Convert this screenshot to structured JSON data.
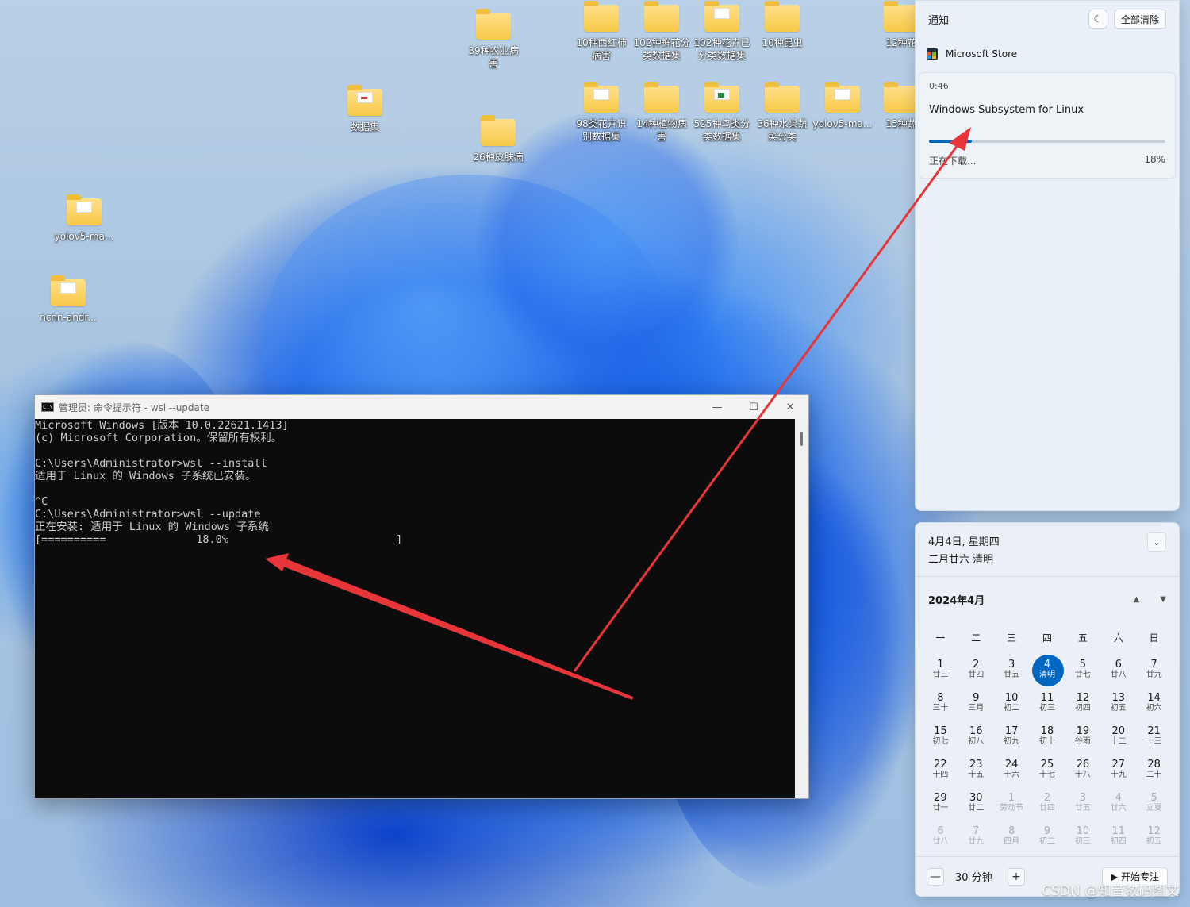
{
  "desktop": {
    "icons": [
      {
        "label": "39种农业病\n害",
        "paper": ""
      },
      {
        "label": "数据集",
        "paper": "red"
      },
      {
        "label": "26种皮肤病",
        "paper": ""
      },
      {
        "label": "yolov5-ma...",
        "paper": "plain"
      },
      {
        "label": "ncnn-andr...",
        "paper": "plain"
      },
      {
        "label": "10种西红柿\n病害",
        "paper": ""
      },
      {
        "label": "102种鲜花分\n类数据集",
        "paper": ""
      },
      {
        "label": "102种花卉已\n分类数据集",
        "paper": "plain"
      },
      {
        "label": "10种昆虫",
        "paper": ""
      },
      {
        "label": "12种花",
        "paper": ""
      },
      {
        "label": "98类花卉识\n别数据集",
        "paper": "plain"
      },
      {
        "label": "14种植物病\n害",
        "paper": ""
      },
      {
        "label": "525种鸟类分\n类数据集",
        "paper": "green"
      },
      {
        "label": "36种水果蔬\n菜分类",
        "paper": ""
      },
      {
        "label": "yolov5-ma...",
        "paper": "plain"
      },
      {
        "label": "15种蔬",
        "paper": ""
      }
    ]
  },
  "cmd": {
    "title": "管理员: 命令提示符 - wsl  --update",
    "icon_text": "C:\\",
    "lines": [
      "Microsoft Windows [版本 10.0.22621.1413]",
      "(c) Microsoft Corporation。保留所有权利。",
      "",
      "C:\\Users\\Administrator>wsl --install",
      "适用于 Linux 的 Windows 子系统已安装。",
      "",
      "^C",
      "C:\\Users\\Administrator>wsl --update",
      "正在安装: 适用于 Linux 的 Windows 子系统",
      "[==========              18.0%                          ]"
    ],
    "buttons": {
      "minimize": "—",
      "maximize": "☐",
      "close": "✕"
    }
  },
  "notifications": {
    "title": "通知",
    "clear_all": "全部清除",
    "focus_icon": "☾",
    "app": "Microsoft Store",
    "card": {
      "time": "0:46",
      "name": "Windows Subsystem for Linux",
      "status": "正在下载...",
      "percent_label": "18%",
      "progress": 0.18
    },
    "colors": {
      "accent": "#0067c0"
    }
  },
  "calendar": {
    "date_line": "4月4日, 星期四",
    "lunar_line": "二月廿六 清明",
    "collapse_icon": "⌄",
    "month": "2024年4月",
    "nav_up": "▲",
    "nav_down": "▼",
    "weekdays": [
      "一",
      "二",
      "三",
      "四",
      "五",
      "六",
      "日"
    ],
    "weeks": [
      [
        {
          "d": "1",
          "l": "廿三"
        },
        {
          "d": "2",
          "l": "廿四"
        },
        {
          "d": "3",
          "l": "廿五"
        },
        {
          "d": "4",
          "l": "清明",
          "today": true
        },
        {
          "d": "5",
          "l": "廿七"
        },
        {
          "d": "6",
          "l": "廿八"
        },
        {
          "d": "7",
          "l": "廿九"
        }
      ],
      [
        {
          "d": "8",
          "l": "三十"
        },
        {
          "d": "9",
          "l": "三月"
        },
        {
          "d": "10",
          "l": "初二"
        },
        {
          "d": "11",
          "l": "初三"
        },
        {
          "d": "12",
          "l": "初四"
        },
        {
          "d": "13",
          "l": "初五"
        },
        {
          "d": "14",
          "l": "初六"
        }
      ],
      [
        {
          "d": "15",
          "l": "初七"
        },
        {
          "d": "16",
          "l": "初八"
        },
        {
          "d": "17",
          "l": "初九"
        },
        {
          "d": "18",
          "l": "初十"
        },
        {
          "d": "19",
          "l": "谷雨"
        },
        {
          "d": "20",
          "l": "十二"
        },
        {
          "d": "21",
          "l": "十三"
        }
      ],
      [
        {
          "d": "22",
          "l": "十四"
        },
        {
          "d": "23",
          "l": "十五"
        },
        {
          "d": "24",
          "l": "十六"
        },
        {
          "d": "25",
          "l": "十七"
        },
        {
          "d": "26",
          "l": "十八"
        },
        {
          "d": "27",
          "l": "十九"
        },
        {
          "d": "28",
          "l": "二十"
        }
      ],
      [
        {
          "d": "29",
          "l": "廿一"
        },
        {
          "d": "30",
          "l": "廿二"
        },
        {
          "d": "1",
          "l": "劳动节",
          "other": true
        },
        {
          "d": "2",
          "l": "廿四",
          "other": true
        },
        {
          "d": "3",
          "l": "廿五",
          "other": true
        },
        {
          "d": "4",
          "l": "廿六",
          "other": true
        },
        {
          "d": "5",
          "l": "立夏",
          "other": true
        }
      ],
      [
        {
          "d": "6",
          "l": "廿八",
          "other": true
        },
        {
          "d": "7",
          "l": "廿九",
          "other": true
        },
        {
          "d": "8",
          "l": "四月",
          "other": true
        },
        {
          "d": "9",
          "l": "初二",
          "other": true
        },
        {
          "d": "10",
          "l": "初三",
          "other": true
        },
        {
          "d": "11",
          "l": "初四",
          "other": true
        },
        {
          "d": "12",
          "l": "初五",
          "other": true
        }
      ]
    ],
    "focus": {
      "minus": "—",
      "value": "30 分钟",
      "plus": "+",
      "start": "▶ 开始专注"
    }
  },
  "watermark": "CSDN @知音数码图文"
}
